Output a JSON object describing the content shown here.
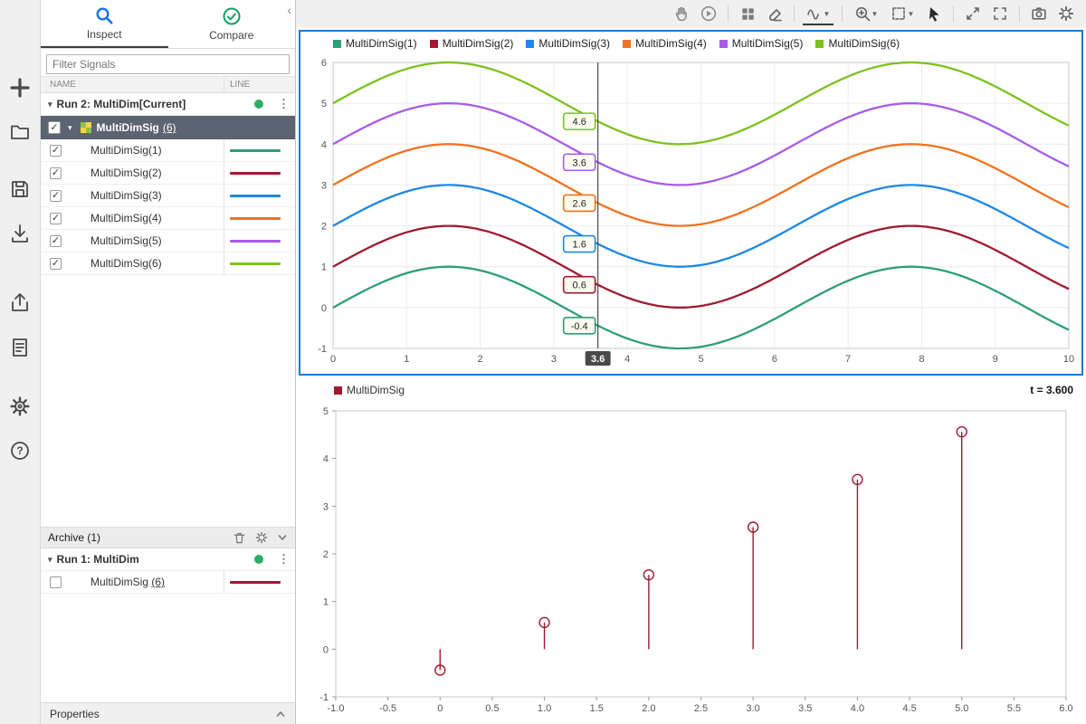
{
  "tabs": {
    "inspect": "Inspect",
    "compare": "Compare"
  },
  "sidebar": {
    "filter_placeholder": "Filter Signals",
    "columns": {
      "name": "NAME",
      "line": "LINE"
    },
    "run2": {
      "label": "Run 2: MultiDim[Current]"
    },
    "group": {
      "name": "MultiDimSig",
      "count": "(6)"
    },
    "signals": [
      {
        "name": "MultiDimSig(1)",
        "color": "#2e9e77",
        "checked": true
      },
      {
        "name": "MultiDimSig(2)",
        "color": "#9e1b32",
        "checked": true
      },
      {
        "name": "MultiDimSig(3)",
        "color": "#1e88e5",
        "checked": true
      },
      {
        "name": "MultiDimSig(4)",
        "color": "#f2711d",
        "checked": true
      },
      {
        "name": "MultiDimSig(5)",
        "color": "#a85ce8",
        "checked": true
      },
      {
        "name": "MultiDimSig(6)",
        "color": "#7dc21e",
        "checked": true
      }
    ],
    "archive": {
      "label": "Archive (1)"
    },
    "run1": {
      "label": "Run 1: MultiDim"
    },
    "archive_signal": {
      "name": "MultiDimSig",
      "count": "(6)",
      "color": "#9e1b32",
      "checked": false
    },
    "properties_label": "Properties"
  },
  "chart_data": [
    {
      "type": "line",
      "function": "sin(x) + offset",
      "x_range": [
        0,
        10
      ],
      "y_range": [
        -1,
        6
      ],
      "x_ticks": [
        0,
        1,
        2,
        3,
        4,
        5,
        6,
        7,
        8,
        9,
        10
      ],
      "y_ticks": [
        -1,
        0,
        1,
        2,
        3,
        4,
        5,
        6
      ],
      "grid": true,
      "legend_position": "top",
      "series": [
        {
          "name": "MultiDimSig(1)",
          "color": "#2e9e77",
          "offset": 0
        },
        {
          "name": "MultiDimSig(2)",
          "color": "#9e1b32",
          "offset": 1
        },
        {
          "name": "MultiDimSig(3)",
          "color": "#1e88e5",
          "offset": 2
        },
        {
          "name": "MultiDimSig(4)",
          "color": "#f2711d",
          "offset": 3
        },
        {
          "name": "MultiDimSig(5)",
          "color": "#a85ce8",
          "offset": 4
        },
        {
          "name": "MultiDimSig(6)",
          "color": "#7dc21e",
          "offset": 5
        }
      ],
      "cursor": {
        "x": 3.6,
        "tag": "3.6",
        "values": [
          "-0.4",
          "0.6",
          "1.6",
          "2.6",
          "3.6",
          "4.6"
        ]
      }
    },
    {
      "type": "stem",
      "legend": "MultiDimSig",
      "color": "#9e1b32",
      "time_label": "t = 3.600",
      "x": [
        0,
        1,
        2,
        3,
        4,
        5
      ],
      "values": [
        -0.44,
        0.56,
        1.56,
        2.56,
        3.56,
        4.56
      ],
      "x_range": [
        -1,
        6
      ],
      "y_range": [
        -1,
        5
      ],
      "x_ticks": [
        -1,
        -0.5,
        0,
        0.5,
        1,
        1.5,
        2,
        2.5,
        3,
        3.5,
        4,
        4.5,
        5,
        5.5,
        6
      ],
      "x_tick_labels": [
        "-1.0",
        "-0.5",
        "0",
        "0.5",
        "1.0",
        "1.5",
        "2.0",
        "2.5",
        "3.0",
        "3.5",
        "4.0",
        "4.5",
        "5.0",
        "5.5",
        "6.0"
      ],
      "y_ticks": [
        -1,
        0,
        1,
        2,
        3,
        4,
        5
      ],
      "grid": false
    }
  ]
}
